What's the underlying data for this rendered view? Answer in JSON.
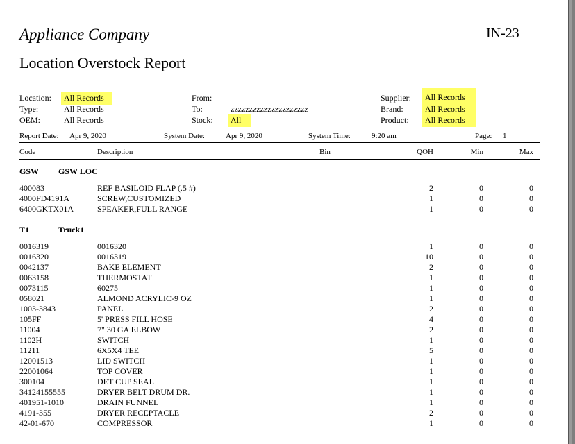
{
  "header": {
    "company": "Appliance Company",
    "report_id": "IN-23",
    "title": "Location Overstock Report"
  },
  "filters": {
    "location_label": "Location:",
    "location_value": "All Records",
    "type_label": "Type:",
    "type_value": "All Records",
    "oem_label": "OEM:",
    "oem_value": "All Records",
    "from_label": "From:",
    "from_value": "",
    "to_label": "To:",
    "to_value": "zzzzzzzzzzzzzzzzzzzzz",
    "stock_label": "Stock:",
    "stock_value": "All",
    "supplier_label": "Supplier:",
    "supplier_value": "All Records",
    "brand_label": "Brand:",
    "brand_value": "All Records",
    "product_label": "Product:",
    "product_value": "All Records"
  },
  "info": {
    "report_date_label": "Report Date:",
    "report_date": "Apr 9, 2020",
    "system_date_label": "System Date:",
    "system_date": "Apr 9, 2020",
    "system_time_label": "System Time:",
    "system_time": "9:20 am",
    "page_label": "Page:",
    "page": "1"
  },
  "columns": {
    "code": "Code",
    "description": "Description",
    "bin": "Bin",
    "qoh": "QOH",
    "min": "Min",
    "max": "Max"
  },
  "groups": [
    {
      "code": "GSW",
      "name": "GSW LOC",
      "rows": [
        {
          "code": "400083",
          "desc": "REF BASILOID FLAP (.5 #)",
          "qoh": "2",
          "min": "0",
          "max": "0"
        },
        {
          "code": "4000FD4191A",
          "desc": "SCREW,CUSTOMIZED",
          "qoh": "1",
          "min": "0",
          "max": "0"
        },
        {
          "code": "6400GKTX01A",
          "desc": "SPEAKER,FULL RANGE",
          "qoh": "1",
          "min": "0",
          "max": "0"
        }
      ]
    },
    {
      "code": "T1",
      "name": "Truck1",
      "rows": [
        {
          "code": "0016319",
          "desc": "0016320",
          "qoh": "1",
          "min": "0",
          "max": "0"
        },
        {
          "code": "0016320",
          "desc": "0016319",
          "qoh": "10",
          "min": "0",
          "max": "0"
        },
        {
          "code": "0042137",
          "desc": "BAKE ELEMENT",
          "qoh": "2",
          "min": "0",
          "max": "0"
        },
        {
          "code": "0063158",
          "desc": "THERMOSTAT",
          "qoh": "1",
          "min": "0",
          "max": "0"
        },
        {
          "code": "0073115",
          "desc": "60275",
          "qoh": "1",
          "min": "0",
          "max": "0"
        },
        {
          "code": "058021",
          "desc": "ALMOND ACRYLIC-9 OZ",
          "qoh": "1",
          "min": "0",
          "max": "0"
        },
        {
          "code": "1003-3843",
          "desc": "PANEL",
          "qoh": "2",
          "min": "0",
          "max": "0"
        },
        {
          "code": "105FF",
          "desc": "5' PRESS FILL HOSE",
          "qoh": "4",
          "min": "0",
          "max": "0"
        },
        {
          "code": "11004",
          "desc": "7\" 30 GA ELBOW",
          "qoh": "2",
          "min": "0",
          "max": "0"
        },
        {
          "code": "1102H",
          "desc": "SWITCH",
          "qoh": "1",
          "min": "0",
          "max": "0"
        },
        {
          "code": "11211",
          "desc": "6X5X4 TEE",
          "qoh": "5",
          "min": "0",
          "max": "0"
        },
        {
          "code": "12001513",
          "desc": "LID SWITCH",
          "qoh": "1",
          "min": "0",
          "max": "0"
        },
        {
          "code": "22001064",
          "desc": "TOP COVER",
          "qoh": "1",
          "min": "0",
          "max": "0"
        },
        {
          "code": "300104",
          "desc": "DET CUP SEAL",
          "qoh": "1",
          "min": "0",
          "max": "0"
        },
        {
          "code": "34124155555",
          "desc": "DRYER BELT DRUM DR.",
          "qoh": "1",
          "min": "0",
          "max": "0"
        },
        {
          "code": "401951-1010",
          "desc": "DRAIN FUNNEL",
          "qoh": "1",
          "min": "0",
          "max": "0"
        },
        {
          "code": "4191-355",
          "desc": "DRYER RECEPTACLE",
          "qoh": "2",
          "min": "0",
          "max": "0"
        },
        {
          "code": "42-01-670",
          "desc": "COMPRESSOR",
          "qoh": "1",
          "min": "0",
          "max": "0"
        }
      ]
    }
  ]
}
